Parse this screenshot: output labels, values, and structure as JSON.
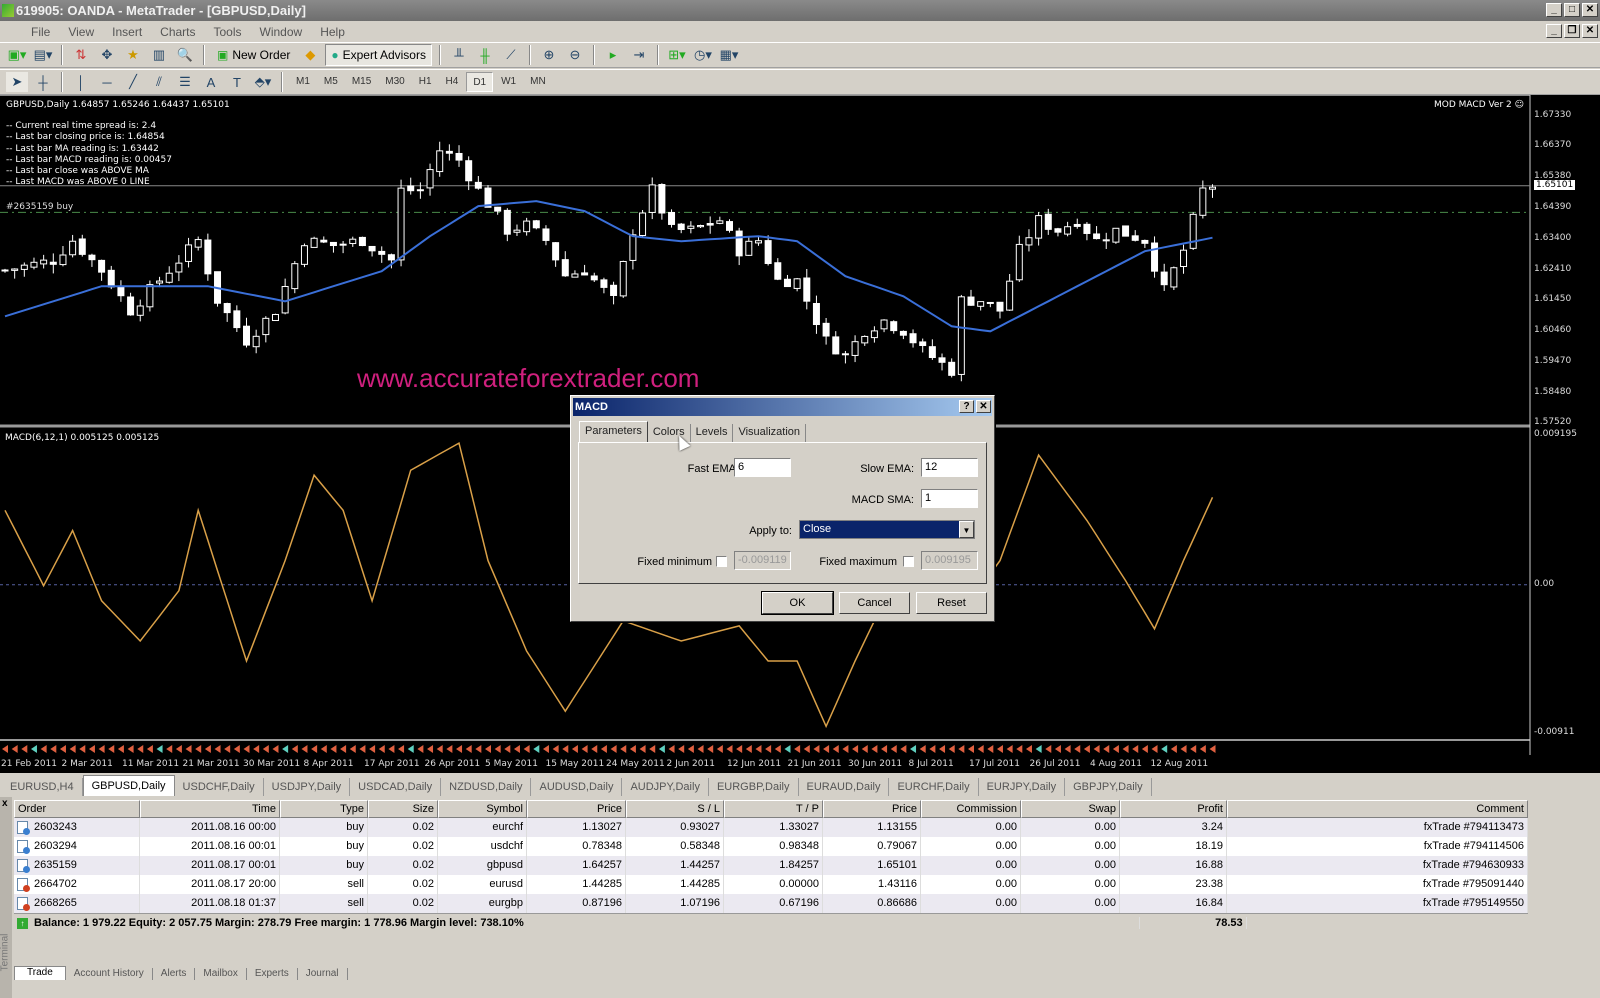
{
  "window": {
    "title": "619905: OANDA - MetaTrader - [GBPUSD,Daily]"
  },
  "menu": [
    "File",
    "View",
    "Insert",
    "Charts",
    "Tools",
    "Window",
    "Help"
  ],
  "toolbar": {
    "new_order": "New Order",
    "expert_advisors": "Expert Advisors"
  },
  "timeframes": [
    "M1",
    "M5",
    "M15",
    "M30",
    "H1",
    "H4",
    "D1",
    "W1",
    "MN"
  ],
  "active_timeframe": "D1",
  "chart": {
    "header": "GBPUSD,Daily  1.64857 1.65246 1.64437 1.65101",
    "info": [
      "-- Current real time spread is:  2.4",
      "-- Last bar closing price is:  1.64854",
      "-- Last bar MA reading is:  1.63442",
      "-- Last bar MACD reading is:  0.00457",
      "-- Last bar close was  ABOVE MA",
      "-- Last MACD was  ABOVE 0 LINE"
    ],
    "order_label": "#2635159 buy",
    "indicator_name": "MOD MACD Ver 2",
    "watermark": "www.accurateforextrader.com",
    "macd_header": "MACD(6,12,1) 0.005125 0.005125",
    "current_price": "1.65101",
    "colors": {
      "ma": "#3a6fd8",
      "macd": "#d9a048",
      "bull": "#ffffff",
      "bear": "#ffffff",
      "watermark": "#d0207e"
    }
  },
  "chart_data": {
    "type": "candlestick",
    "symbol": "GBPUSD",
    "timeframe": "Daily",
    "price_ticks": [
      "1.67330",
      "1.66370",
      "1.65380",
      "1.64390",
      "1.63400",
      "1.62410",
      "1.61450",
      "1.60460",
      "1.59470",
      "1.58480",
      "1.57520"
    ],
    "price_range": [
      1.5752,
      1.6733
    ],
    "bid_line": 1.65101,
    "order_line": 1.6425,
    "bars": 126,
    "key_closes": [
      [
        0,
        1.624
      ],
      [
        5,
        1.6272
      ],
      [
        7,
        1.6336
      ],
      [
        10,
        1.624
      ],
      [
        13,
        1.6112
      ],
      [
        16,
        1.6208
      ],
      [
        20,
        1.6336
      ],
      [
        22,
        1.6144
      ],
      [
        25,
        1.6016
      ],
      [
        28,
        1.6112
      ],
      [
        31,
        1.6336
      ],
      [
        34,
        1.632
      ],
      [
        37,
        1.6336
      ],
      [
        40,
        1.6272
      ],
      [
        41,
        1.6496
      ],
      [
        43,
        1.6496
      ],
      [
        45,
        1.6624
      ],
      [
        47,
        1.6592
      ],
      [
        49,
        1.6496
      ],
      [
        52,
        1.6368
      ],
      [
        54,
        1.6384
      ],
      [
        56,
        1.6336
      ],
      [
        58,
        1.6224
      ],
      [
        60,
        1.624
      ],
      [
        63,
        1.6144
      ],
      [
        65,
        1.6368
      ],
      [
        67,
        1.6496
      ],
      [
        69,
        1.6368
      ],
      [
        71,
        1.6368
      ],
      [
        74,
        1.64
      ],
      [
        76,
        1.6304
      ],
      [
        78,
        1.6336
      ],
      [
        80,
        1.6208
      ],
      [
        82,
        1.6208
      ],
      [
        85,
        1.6016
      ],
      [
        87,
        1.5968
      ],
      [
        89,
        1.6048
      ],
      [
        91,
        1.608
      ],
      [
        93,
        1.6048
      ],
      [
        95,
        1.5984
      ],
      [
        98,
        1.592
      ],
      [
        99,
        1.6144
      ],
      [
        101,
        1.6144
      ],
      [
        103,
        1.6112
      ],
      [
        105,
        1.6304
      ],
      [
        107,
        1.64
      ],
      [
        109,
        1.6368
      ],
      [
        111,
        1.64
      ],
      [
        113,
        1.6336
      ],
      [
        115,
        1.6368
      ],
      [
        118,
        1.6336
      ],
      [
        120,
        1.6176
      ],
      [
        122,
        1.6304
      ],
      [
        124,
        1.6496
      ],
      [
        125,
        1.651
      ]
    ],
    "ma": [
      [
        0,
        1.6093
      ],
      [
        10,
        1.6189
      ],
      [
        21,
        1.6189
      ],
      [
        29,
        1.6141
      ],
      [
        39,
        1.6237
      ],
      [
        44,
        1.6349
      ],
      [
        49,
        1.6445
      ],
      [
        55,
        1.6461
      ],
      [
        60,
        1.6429
      ],
      [
        65,
        1.6349
      ],
      [
        70,
        1.6333
      ],
      [
        78,
        1.6349
      ],
      [
        82,
        1.6333
      ],
      [
        87,
        1.6221
      ],
      [
        93,
        1.6157
      ],
      [
        98,
        1.6061
      ],
      [
        102,
        1.6045
      ],
      [
        108,
        1.6141
      ],
      [
        113,
        1.6221
      ],
      [
        118,
        1.6301
      ],
      [
        125,
        1.6344
      ]
    ],
    "macd": {
      "params": {
        "fast": 6,
        "slow": 12,
        "sma": 1
      },
      "ticks": [
        "0.009195",
        "0.00",
        "-0.00911"
      ],
      "range": [
        -0.00911,
        0.009195
      ],
      "values": [
        [
          0,
          0.00457
        ],
        [
          4,
          -6e-05
        ],
        [
          7,
          0.00333
        ],
        [
          10,
          -0.00099
        ],
        [
          14,
          -0.00346
        ],
        [
          18,
          -0.00037
        ],
        [
          20,
          0.00457
        ],
        [
          25,
          -0.00469
        ],
        [
          29,
          0.00148
        ],
        [
          32,
          0.00673
        ],
        [
          35,
          0.00457
        ],
        [
          38,
          -0.00099
        ],
        [
          42,
          0.00703
        ],
        [
          47,
          0.0087
        ],
        [
          50,
          0.00148
        ],
        [
          54,
          -0.00407
        ],
        [
          58,
          -0.00777
        ],
        [
          64,
          -0.00222
        ],
        [
          70,
          -0.00346
        ],
        [
          76,
          -0.00253
        ],
        [
          79,
          -0.00469
        ],
        [
          82,
          -0.00469
        ],
        [
          85,
          -0.0087
        ],
        [
          88,
          -0.00469
        ],
        [
          90,
          -0.00222
        ],
        [
          95,
          -0.00099
        ],
        [
          100,
          -0.00099
        ],
        [
          103,
          0.00148
        ],
        [
          107,
          0.00796
        ],
        [
          112,
          0.00395
        ],
        [
          116,
          0.00025
        ],
        [
          119,
          -0.00271
        ],
        [
          122,
          0.00148
        ],
        [
          125,
          0.00537
        ]
      ]
    },
    "dates": [
      "21 Feb 2011",
      "2 Mar 2011",
      "11 Mar 2011",
      "21 Mar 2011",
      "30 Mar 2011",
      "8 Apr 2011",
      "17 Apr 2011",
      "26 Apr 2011",
      "5 May 2011",
      "15 May 2011",
      "24 May 2011",
      "2 Jun 2011",
      "12 Jun 2011",
      "21 Jun 2011",
      "30 Jun 2011",
      "8 Jul 2011",
      "17 Jul 2011",
      "26 Jul 2011",
      "4 Aug 2011",
      "12 Aug 2011"
    ]
  },
  "chart_tabs": [
    "EURUSD,H4",
    "GBPUSD,Daily",
    "USDCHF,Daily",
    "USDJPY,Daily",
    "USDCAD,Daily",
    "NZDUSD,Daily",
    "AUDUSD,Daily",
    "AUDJPY,Daily",
    "EURGBP,Daily",
    "EURAUD,Daily",
    "EURCHF,Daily",
    "EURJPY,Daily",
    "GBPJPY,Daily"
  ],
  "active_chart_tab": "GBPUSD,Daily",
  "dialog": {
    "title": "MACD",
    "help": "?",
    "close": "✕",
    "tabs": [
      "Parameters",
      "Colors",
      "Levels",
      "Visualization"
    ],
    "fast_ema_label": "Fast EMA:",
    "fast_ema": "6",
    "slow_ema_label": "Slow EMA:",
    "slow_ema": "12",
    "macd_sma_label": "MACD SMA:",
    "macd_sma": "1",
    "apply_label": "Apply to:",
    "apply_value": "Close",
    "fixed_min_label": "Fixed minimum",
    "fixed_min": "-0.009119",
    "fixed_max_label": "Fixed maximum",
    "fixed_max": "0.009195",
    "ok": "OK",
    "cancel": "Cancel",
    "reset": "Reset"
  },
  "terminal": {
    "side_label": "Terminal",
    "columns": [
      "Order",
      "Time",
      "Type",
      "Size",
      "Symbol",
      "Price",
      "S / L",
      "T / P",
      "Price",
      "Commission",
      "Swap",
      "Profit",
      "Comment"
    ],
    "rows": [
      [
        "2603243",
        "2011.08.16 00:00",
        "buy",
        "0.02",
        "eurchf",
        "1.13027",
        "0.93027",
        "1.33027",
        "1.13155",
        "0.00",
        "0.00",
        "3.24",
        "fxTrade #794113473"
      ],
      [
        "2603294",
        "2011.08.16 00:01",
        "buy",
        "0.02",
        "usdchf",
        "0.78348",
        "0.58348",
        "0.98348",
        "0.79067",
        "0.00",
        "0.00",
        "18.19",
        "fxTrade #794114506"
      ],
      [
        "2635159",
        "2011.08.17 00:01",
        "buy",
        "0.02",
        "gbpusd",
        "1.64257",
        "1.44257",
        "1.84257",
        "1.65101",
        "0.00",
        "0.00",
        "16.88",
        "fxTrade #794630933"
      ],
      [
        "2664702",
        "2011.08.17 20:00",
        "sell",
        "0.02",
        "eurusd",
        "1.44285",
        "1.44285",
        "0.00000",
        "1.43116",
        "0.00",
        "0.00",
        "23.38",
        "fxTrade #795091440"
      ],
      [
        "2668265",
        "2011.08.18 01:37",
        "sell",
        "0.02",
        "eurgbp",
        "0.87196",
        "1.07196",
        "0.67196",
        "0.86686",
        "0.00",
        "0.00",
        "16.84",
        "fxTrade #795149550"
      ]
    ],
    "balance": "Balance: 1 979.22  Equity: 2 057.75  Margin: 278.79  Free margin: 1 778.96  Margin level: 738.10%",
    "total_profit": "78.53",
    "tabs": [
      "Trade",
      "Account History",
      "Alerts",
      "Mailbox",
      "Experts",
      "Journal"
    ]
  }
}
